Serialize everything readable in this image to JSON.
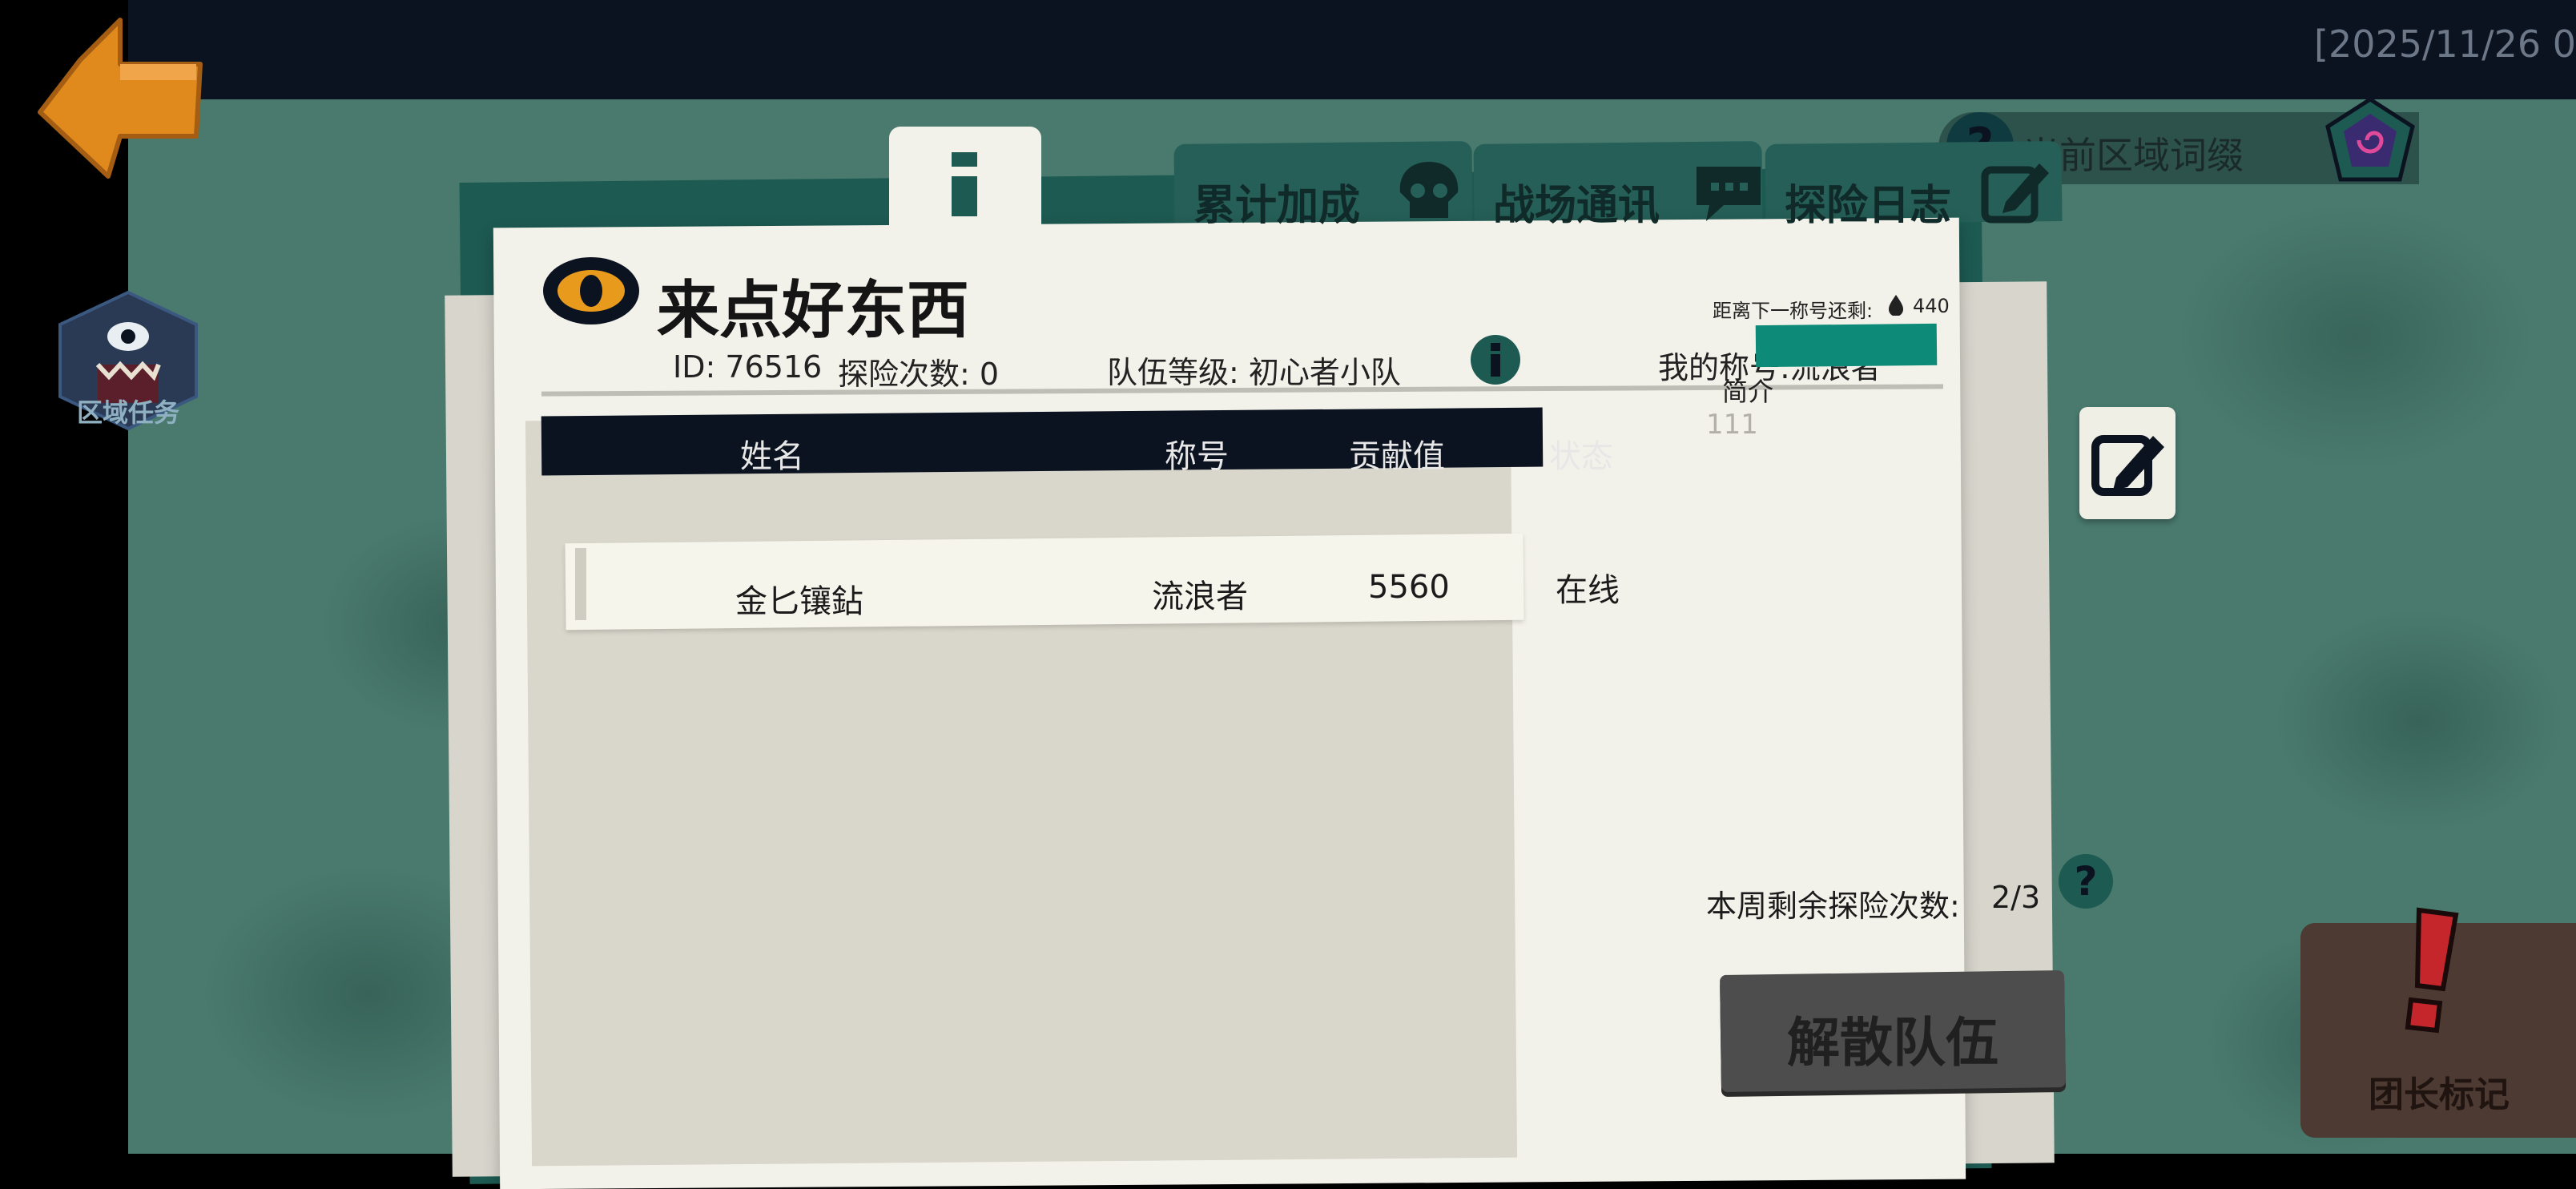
{
  "status_bar": {
    "timestamp": "[2025/11/26 0"
  },
  "nav": {
    "back_icon": "orange-left-arrow",
    "region_task_label": "区域任务",
    "affix_label": "当前区域词缀"
  },
  "tabs": [
    {
      "label": "累计加成",
      "icon": "skull-icon"
    },
    {
      "label": "战场通讯",
      "icon": "chat-icon"
    },
    {
      "label": "探险日志",
      "icon": "pencil-icon"
    }
  ],
  "team": {
    "name": "来点好东西",
    "id_text": "ID: 76516",
    "explore_count_text": "探险次数: 0",
    "level_text": "队伍等级: 初心者小队",
    "next_title_text": "距离下一称号还剩:",
    "next_title_value": "440",
    "my_title_text": "我的称号:流浪者",
    "intro_label": "简介",
    "intro_text": "111"
  },
  "table": {
    "headers": [
      "姓名",
      "称号",
      "贡献值",
      "状态"
    ],
    "rows": [
      {
        "name": "金匕镶鉆",
        "title": "流浪者",
        "contribution": "5560",
        "status": "在线"
      }
    ]
  },
  "weekly": {
    "label": "本周剩余探险次数:",
    "value": "2/3"
  },
  "buttons": {
    "disband": "解散队伍",
    "leader_mark": "团长标记"
  },
  "colors": {
    "background": "#4a7a6e",
    "dark": "#0b1220",
    "paper": "#f3f2ea",
    "accent_teal": "#255f57",
    "orange": "#e08a1e",
    "leader_red": "#c4262b"
  }
}
